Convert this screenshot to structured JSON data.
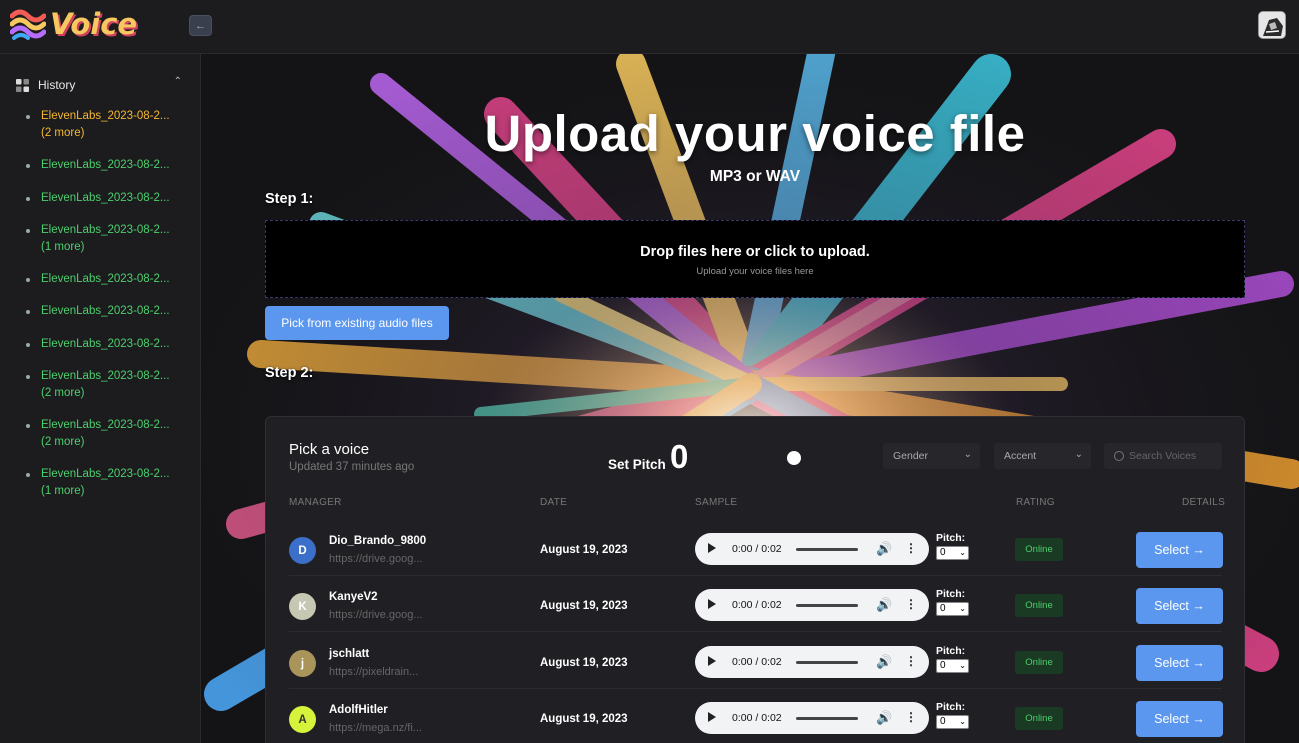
{
  "app": {
    "logo_text": "Voice",
    "collapse_icon": "arrow-left-icon"
  },
  "sidebar": {
    "history_label": "History",
    "items": [
      {
        "line1": "ElevenLabs_2023-08-2...",
        "line2": "(2 more)",
        "active": true
      },
      {
        "line1": "ElevenLabs_2023-08-2...",
        "line2": ""
      },
      {
        "line1": "ElevenLabs_2023-08-2...",
        "line2": ""
      },
      {
        "line1": "ElevenLabs_2023-08-2...",
        "line2": "(1 more)"
      },
      {
        "line1": "ElevenLabs_2023-08-2...",
        "line2": ""
      },
      {
        "line1": "ElevenLabs_2023-08-2...",
        "line2": ""
      },
      {
        "line1": "ElevenLabs_2023-08-2...",
        "line2": ""
      },
      {
        "line1": "ElevenLabs_2023-08-2...",
        "line2": "(2 more)"
      },
      {
        "line1": "ElevenLabs_2023-08-2...",
        "line2": "(2 more)"
      },
      {
        "line1": "ElevenLabs_2023-08-2...",
        "line2": "(1 more)"
      }
    ]
  },
  "main": {
    "title": "Upload your voice file",
    "subtitle": "MP3 or WAV",
    "step1": "Step 1:",
    "dropzone": {
      "main": "Drop files here or click to upload.",
      "sub": "Upload your voice files here"
    },
    "pick_button": "Pick from existing audio files",
    "step2": "Step 2:"
  },
  "panel": {
    "title": "Pick a voice",
    "updated": "Updated 37 minutes ago",
    "pitch_label": "Set Pitch",
    "pitch_value": "0",
    "gender_label": "Gender",
    "accent_label": "Accent",
    "search_placeholder": "Search Voices",
    "columns": {
      "manager": "MANAGER",
      "date": "DATE",
      "sample": "SAMPLE",
      "rating": "RATING",
      "details": "DETAILS"
    },
    "rows": [
      {
        "initial": "D",
        "avatar_color": "#3b6fc9",
        "avatar_text_color": "#ffffff",
        "name": "Dio_Brando_9800",
        "link": "https://drive.goog...",
        "date": "August 19, 2023",
        "time": "0:00 / 0:02",
        "pitch_label": "Pitch:",
        "pitch": "0",
        "status": "Online",
        "select": "Select →"
      },
      {
        "initial": "K",
        "avatar_color": "#c7c8b4",
        "avatar_text_color": "#ffffff",
        "name": "KanyeV2",
        "link": "https://drive.goog...",
        "date": "August 19, 2023",
        "time": "0:00 / 0:02",
        "pitch_label": "Pitch:",
        "pitch": "0",
        "status": "Online",
        "select": "Select →"
      },
      {
        "initial": "j",
        "avatar_color": "#a9955a",
        "avatar_text_color": "#ffffff",
        "name": "jschlatt",
        "link": "https://pixeldrain...",
        "date": "August 19, 2023",
        "time": "0:00 / 0:02",
        "pitch_label": "Pitch:",
        "pitch": "0",
        "status": "Online",
        "select": "Select →"
      },
      {
        "initial": "A",
        "avatar_color": "#d6f23a",
        "avatar_text_color": "#333333",
        "name": "AdolfHitler",
        "link": "https://mega.nz/fi...",
        "date": "August 19, 2023",
        "time": "0:00 / 0:02",
        "pitch_label": "Pitch:",
        "pitch": "0",
        "status": "Online",
        "select": "Select →"
      }
    ]
  }
}
